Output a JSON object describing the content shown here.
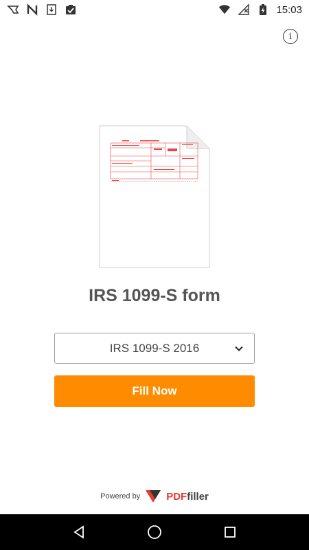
{
  "status_bar": {
    "time": "15:03",
    "icons": [
      "vpn-icon",
      "n-icon",
      "download-icon",
      "clipboard-check-icon",
      "wifi-icon",
      "no-signal-icon",
      "battery-charging-icon"
    ]
  },
  "header": {
    "info_icon": "info-icon"
  },
  "form_title": "IRS 1099-S form",
  "year_select": {
    "selected": "IRS 1099-S 2016"
  },
  "fill_button": {
    "label": "Fill Now"
  },
  "footer": {
    "powered_by": "Powered by",
    "brand_pdf": "PDF",
    "brand_filler": "filler"
  },
  "nav_bar": {
    "icons": [
      "back-icon",
      "home-icon",
      "recents-icon"
    ]
  },
  "colors": {
    "accent": "#ff8c00",
    "brand_red": "#e8392d",
    "form_red": "#e84545"
  }
}
